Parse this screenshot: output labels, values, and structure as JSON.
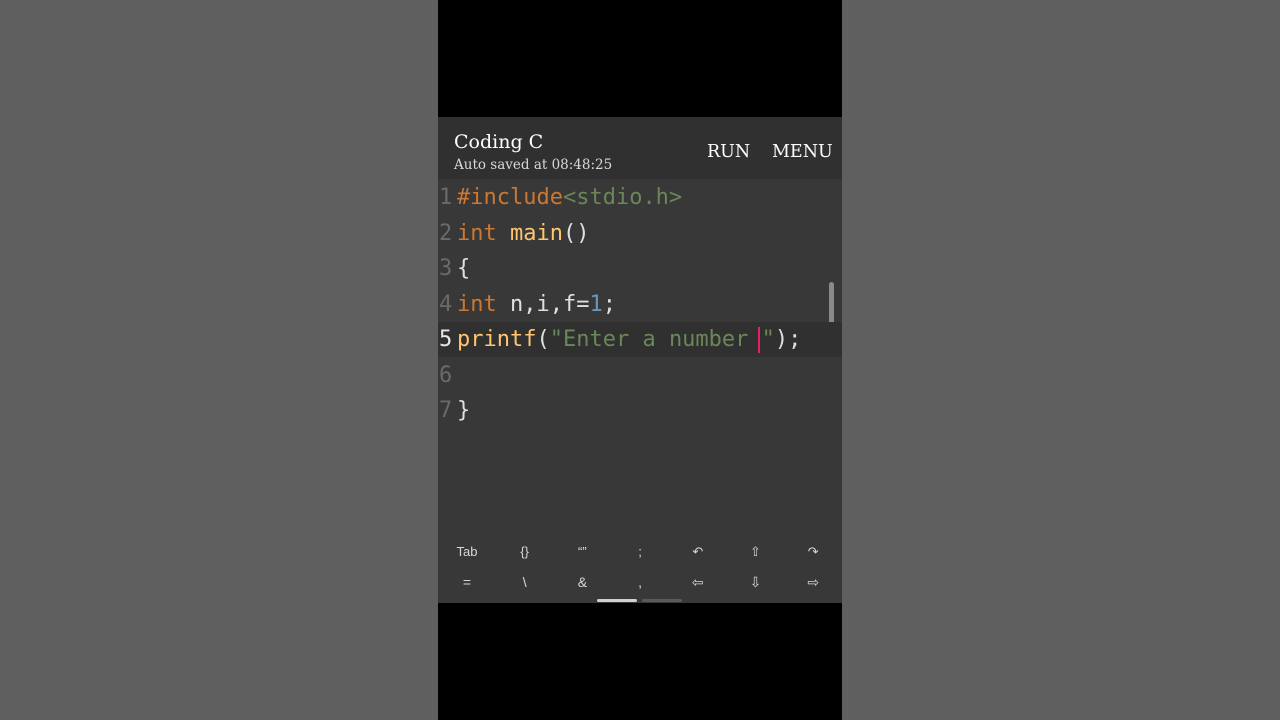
{
  "header": {
    "title": "Coding C",
    "subtitle": "Auto saved at 08:48:25",
    "run_label": "RUN",
    "menu_label": "MENU"
  },
  "editor": {
    "current_line": 5,
    "lines": [
      {
        "num": "1",
        "parts": [
          [
            "kw-pre",
            "#include"
          ],
          [
            "str",
            "<stdio.h>"
          ]
        ]
      },
      {
        "num": "2",
        "parts": [
          [
            "kw",
            "int"
          ],
          [
            "plain",
            " "
          ],
          [
            "fn",
            "main"
          ],
          [
            "plain",
            "()"
          ]
        ]
      },
      {
        "num": "3",
        "parts": [
          [
            "plain",
            "{"
          ]
        ]
      },
      {
        "num": "4",
        "parts": [
          [
            "kw",
            "int"
          ],
          [
            "plain",
            " n,i,f="
          ],
          [
            "num",
            "1"
          ],
          [
            "plain",
            ";"
          ]
        ]
      },
      {
        "num": "5",
        "parts": [
          [
            "fn",
            "printf"
          ],
          [
            "plain",
            "("
          ],
          [
            "str",
            "\"Enter a number "
          ],
          [
            "cursor",
            ""
          ],
          [
            "str",
            "\""
          ],
          [
            "plain",
            ");"
          ]
        ]
      },
      {
        "num": "6",
        "parts": []
      },
      {
        "num": "7",
        "parts": [
          [
            "plain",
            "}"
          ]
        ]
      }
    ]
  },
  "keybar": {
    "row1": [
      {
        "label": "Tab",
        "name": "tab-key"
      },
      {
        "label": "{}",
        "name": "braces-key"
      },
      {
        "label": "“”",
        "name": "quotes-key"
      },
      {
        "label": ";",
        "name": "semicolon-key"
      },
      {
        "label": "↶",
        "name": "undo-icon"
      },
      {
        "label": "⇧",
        "name": "shift-up-icon"
      },
      {
        "label": "↷",
        "name": "redo-icon"
      }
    ],
    "row2": [
      {
        "label": "=",
        "name": "equals-key"
      },
      {
        "label": "\\",
        "name": "backslash-key"
      },
      {
        "label": "&",
        "name": "ampersand-key"
      },
      {
        "label": ",",
        "name": "comma-key"
      },
      {
        "label": "⇦",
        "name": "arrow-left-icon"
      },
      {
        "label": "⇩",
        "name": "arrow-down-icon"
      },
      {
        "label": "⇨",
        "name": "arrow-right-icon"
      }
    ]
  },
  "colors": {
    "keyword": "#cc7832",
    "function": "#ffc66d",
    "string": "#6a8759",
    "number": "#6897bb",
    "cursor": "#e91e63",
    "background": "#383838"
  }
}
